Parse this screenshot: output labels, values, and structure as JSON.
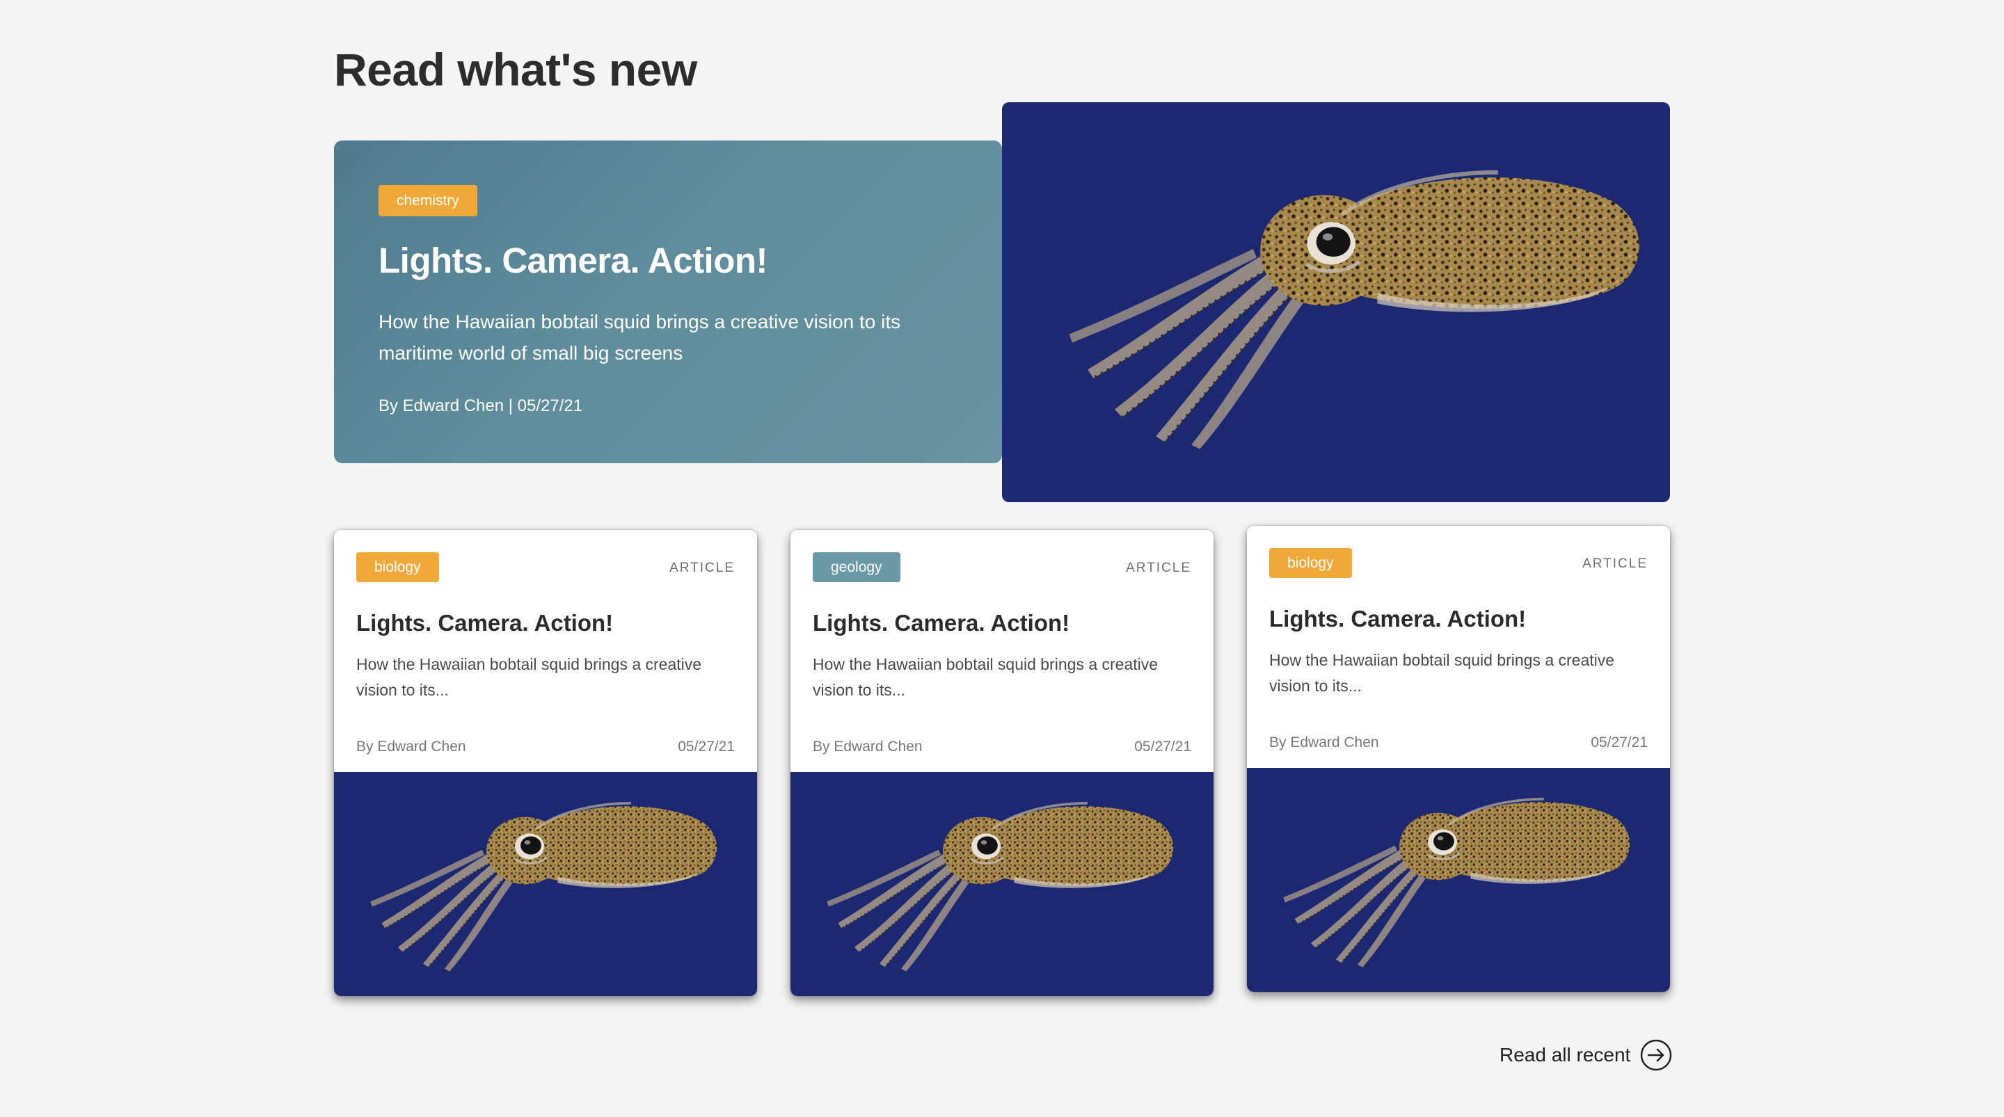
{
  "page": {
    "title": "Read what's new"
  },
  "featured": {
    "category": "chemistry",
    "title": "Lights. Camera. Action!",
    "description": "How the Hawaiian bobtail squid brings a creative vision to its maritime world of small big screens",
    "byline": "By Edward Chen | 05/27/21",
    "image_icon": "bobtail-squid-photo"
  },
  "cards": [
    {
      "category": "biology",
      "category_color": "#f0a838",
      "type": "ARTICLE",
      "title": "Lights. Camera. Action!",
      "description": "How the Hawaiian bobtail squid brings a creative vision to its...",
      "author": "By Edward Chen",
      "date": "05/27/21"
    },
    {
      "category": "geology",
      "category_color": "#6c99a8",
      "type": "ARTICLE",
      "title": "Lights. Camera. Action!",
      "description": "How the Hawaiian bobtail squid brings a creative vision to its...",
      "author": "By Edward Chen",
      "date": "05/27/21"
    },
    {
      "category": "biology",
      "category_color": "#f0a838",
      "type": "ARTICLE",
      "title": "Lights. Camera. Action!",
      "description": "How the Hawaiian bobtail squid brings a creative vision to its...",
      "author": "By Edward Chen",
      "date": "05/27/21"
    }
  ],
  "footer": {
    "read_all_label": "Read all recent",
    "read_all_icon": "arrow-right-circle-icon"
  },
  "colors": {
    "background": "#f4f4f4",
    "featured_card": "#5f8d9c",
    "image_background": "#1d2872",
    "badge_orange": "#f0a838",
    "badge_teal": "#6c99a8"
  }
}
